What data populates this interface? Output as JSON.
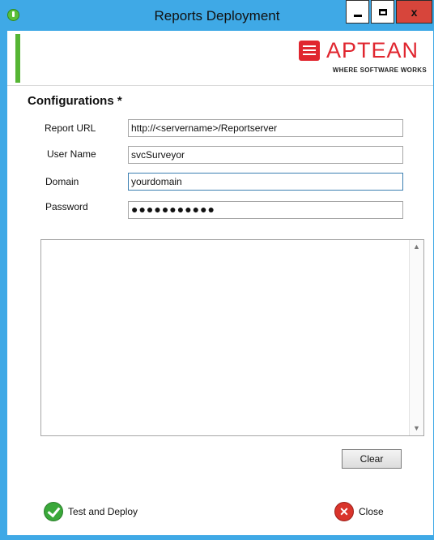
{
  "window": {
    "title": "Reports Deployment",
    "close_glyph": "x"
  },
  "branding": {
    "logo_text": "APTEAN",
    "tagline": "WHERE SOFTWARE WORKS",
    "brand_color": "#e0262f"
  },
  "form": {
    "section_title": "Configurations *",
    "report_url": {
      "label": "Report URL",
      "value": "http://<servername>/Reportserver"
    },
    "user_name": {
      "label": "User Name",
      "value": "svcSurveyor"
    },
    "domain": {
      "label": "Domain",
      "value": "yourdomain"
    },
    "password": {
      "label": "Password",
      "value": "●●●●●●●●●●●"
    }
  },
  "output": {
    "text": "",
    "scroll_up_glyph": "▲",
    "scroll_down_glyph": "▼"
  },
  "actions": {
    "clear_label": "Clear",
    "deploy_label": "Test and Deploy",
    "close_label": "Close",
    "close_icon_glyph": "✕"
  },
  "colors": {
    "titlebar": "#3fa9e6",
    "accent_green": "#56b534"
  }
}
